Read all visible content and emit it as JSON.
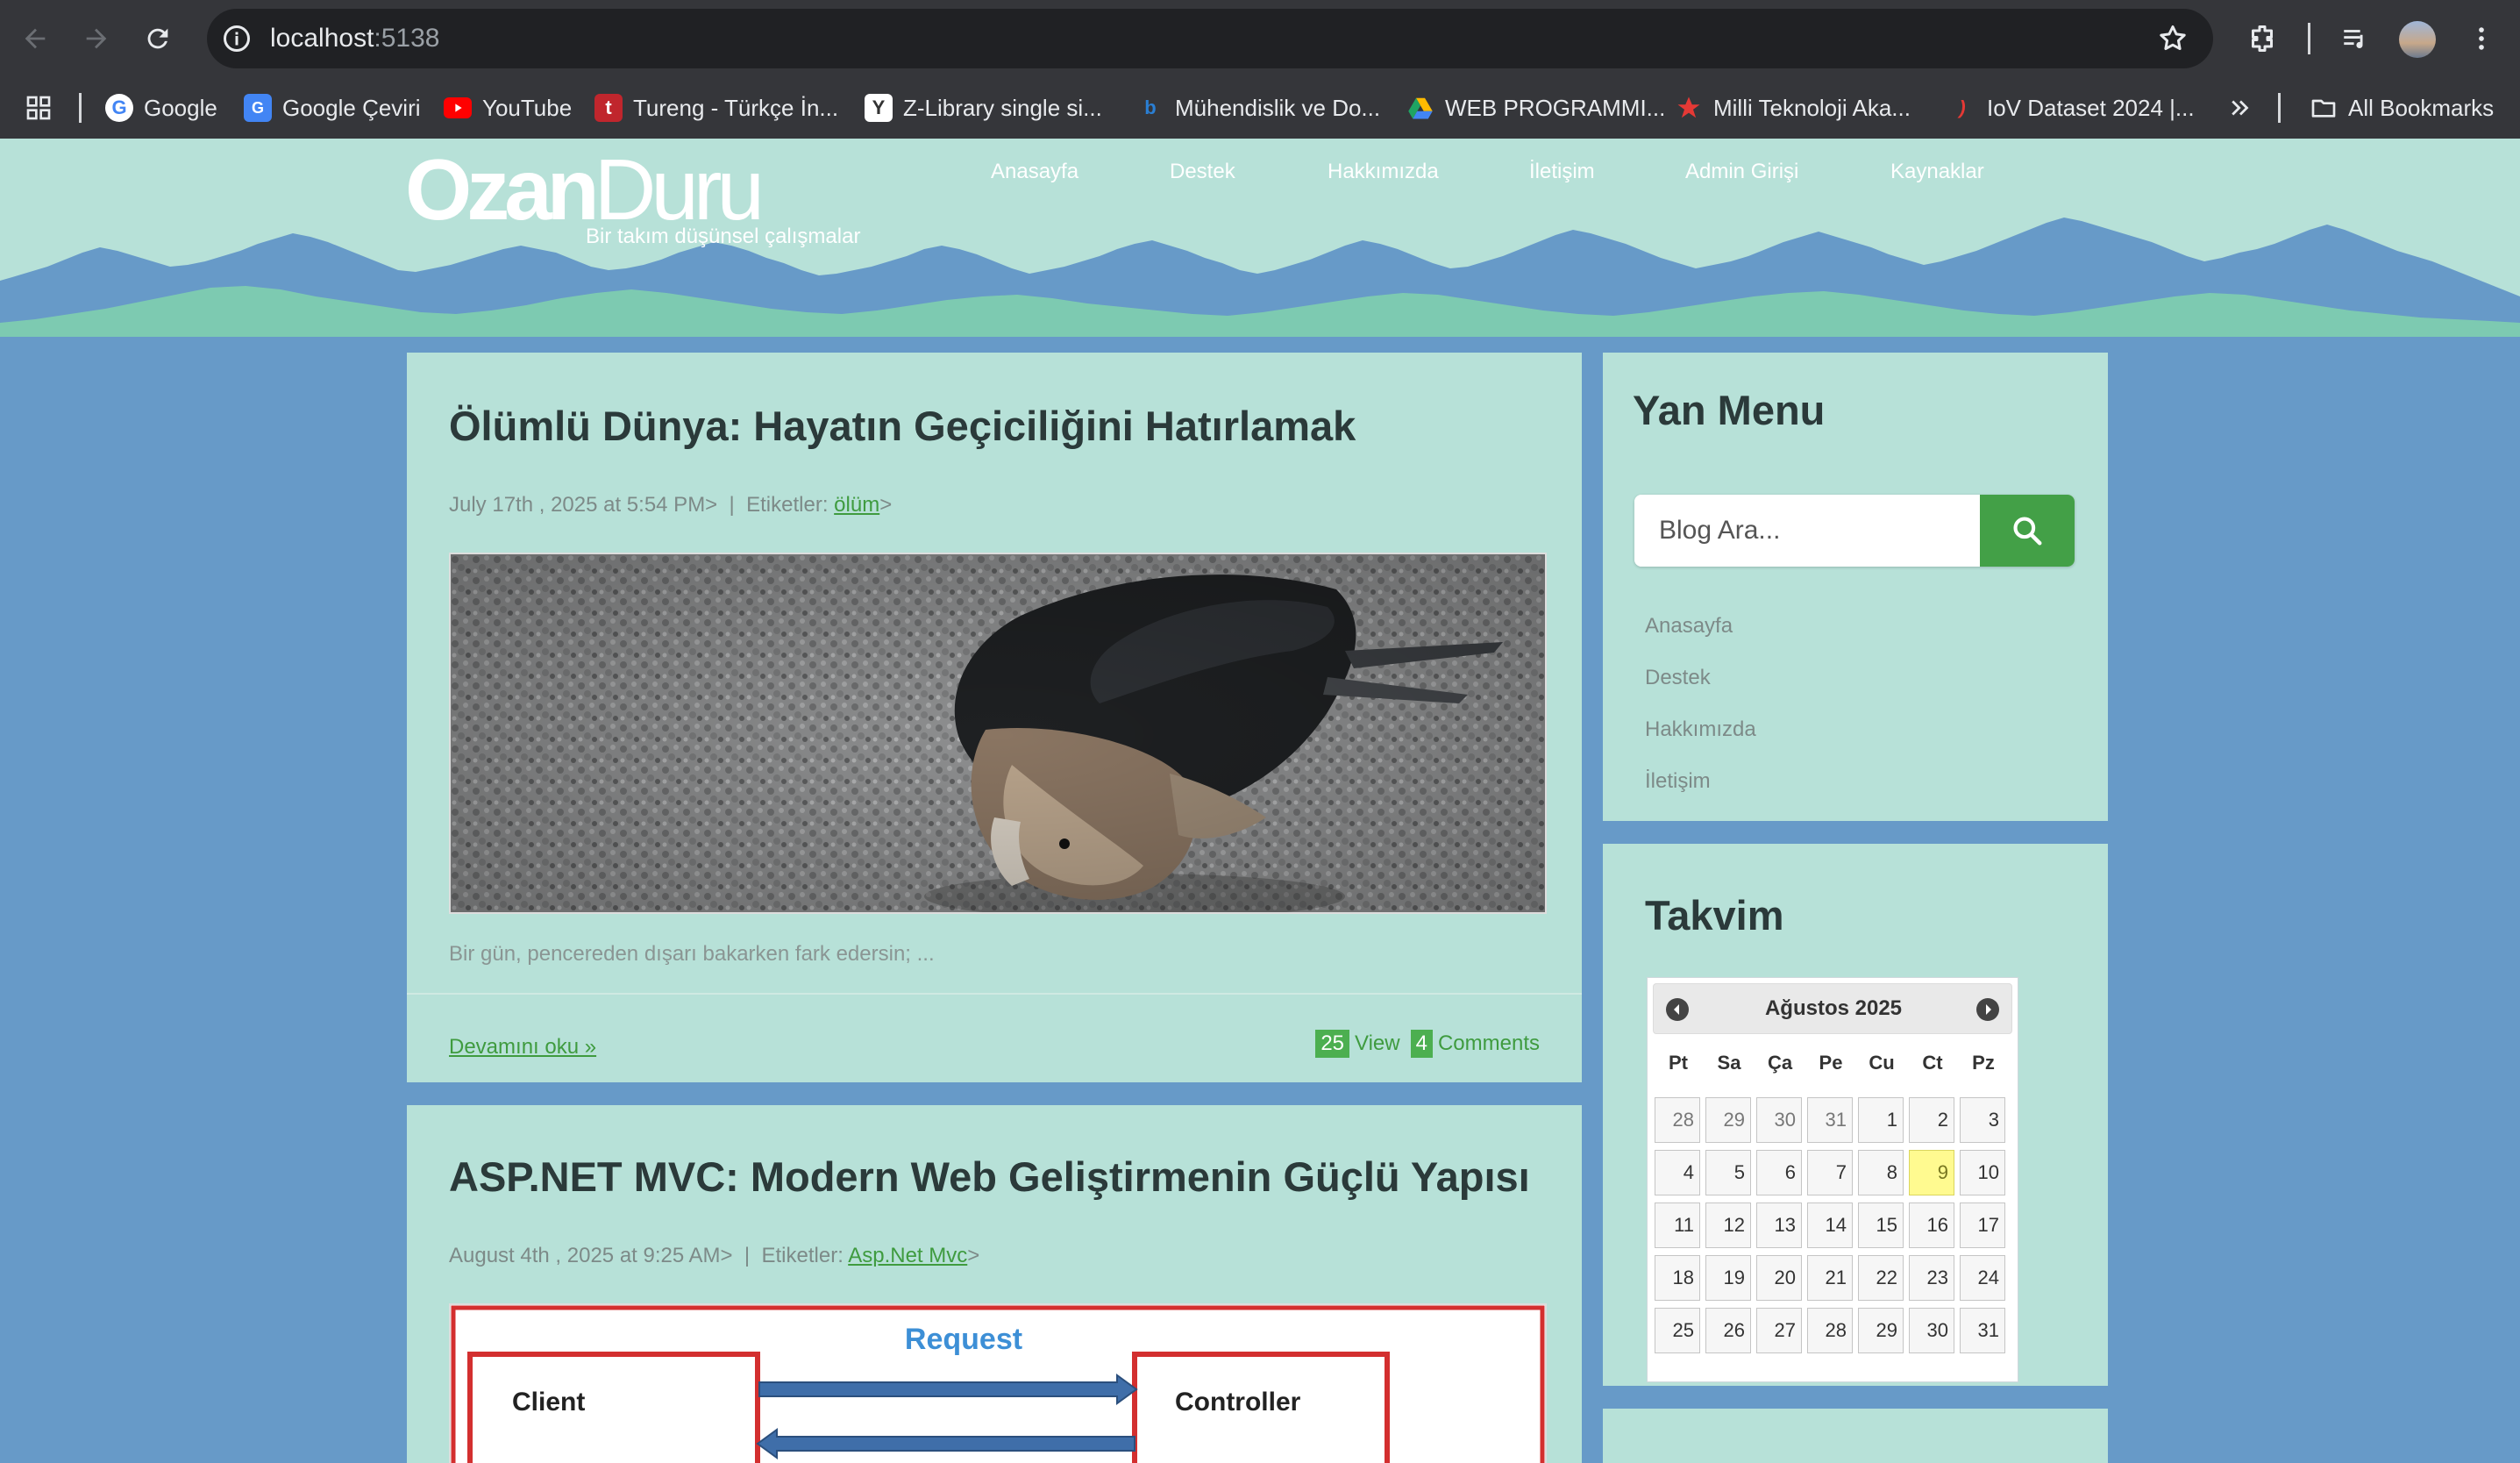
{
  "browser": {
    "url_host": "localhost",
    "url_port": ":5138",
    "bookmarks": [
      {
        "label": "Google",
        "icon": "google-icon",
        "color": "#ffffff"
      },
      {
        "label": "Google Çeviri",
        "icon": "google-translate-icon",
        "color": "#4285f4"
      },
      {
        "label": "YouTube",
        "icon": "youtube-icon",
        "color": "#ff0000"
      },
      {
        "label": "Tureng - Türkçe İn...",
        "icon": "tureng-icon",
        "color": "#c0262d"
      },
      {
        "label": "Z-Library single si...",
        "icon": "zlibrary-icon",
        "color": "#ffffff"
      },
      {
        "label": "Mühendislik ve Do...",
        "icon": "bookmark-b-icon",
        "color": "#2a7fd4"
      },
      {
        "label": "WEB PROGRAMMI...",
        "icon": "google-drive-icon",
        "color": "#1fa463"
      },
      {
        "label": "Milli Teknoloji Aka...",
        "icon": "star-logo-icon",
        "color": "#e53935"
      },
      {
        "label": "IoV Dataset 2024 |...",
        "icon": "ieee-dataport-icon",
        "color": "#e53935"
      }
    ],
    "all_bookmarks": "All Bookmarks"
  },
  "site": {
    "logo_part1": "Ozan",
    "logo_part2": "Duru",
    "tagline": "Bir takım düşünsel çalışmalar",
    "nav": [
      "Anasayfa",
      "Destek",
      "Hakkımızda",
      "İletişim",
      "Admin Girişi",
      "Kaynaklar"
    ]
  },
  "posts": [
    {
      "title": "Ölümlü Dünya: Hayatın Geçiciliğini Hatırlamak",
      "meta_date": "July 17th , 2025 at 5:54 PM>",
      "meta_sep": "|",
      "meta_tag_label": "Etiketler:",
      "meta_tag": "ölüm",
      "meta_tag_suffix": ">",
      "excerpt": "Bir gün, pencereden dışarı bakarken fark edersin; ...",
      "read_more": "Devamını oku »",
      "views": "25",
      "views_label": "View",
      "comments": "4",
      "comments_label": "Comments"
    },
    {
      "title": "ASP.NET MVC: Modern Web Geliştirmenin Güçlü Yapısı",
      "meta_date": "August 4th , 2025 at 9:25 AM>",
      "meta_sep": "|",
      "meta_tag_label": "Etiketler:",
      "meta_tag": "Asp.Net Mvc",
      "meta_tag_suffix": ">",
      "diagram": {
        "request": "Request",
        "client": "Client",
        "controller": "Controller"
      }
    }
  ],
  "sidebar": {
    "menu_title": "Yan Menu",
    "search_placeholder": "Blog Ara...",
    "links": [
      "Anasayfa",
      "Destek",
      "Hakkımızda",
      "İletişim"
    ],
    "calendar_title": "Takvim",
    "calendar": {
      "month": "Ağustos 2025",
      "weekdays": [
        "Pt",
        "Sa",
        "Ça",
        "Pe",
        "Cu",
        "Ct",
        "Pz"
      ],
      "weeks": [
        [
          "28",
          "29",
          "30",
          "31",
          "1",
          "2",
          "3"
        ],
        [
          "4",
          "5",
          "6",
          "7",
          "8",
          "9",
          "10"
        ],
        [
          "11",
          "12",
          "13",
          "14",
          "15",
          "16",
          "17"
        ],
        [
          "18",
          "19",
          "20",
          "21",
          "22",
          "23",
          "24"
        ],
        [
          "25",
          "26",
          "27",
          "28",
          "29",
          "30",
          "31"
        ]
      ],
      "today": "9"
    }
  },
  "colors": {
    "accent_green": "#43a047",
    "card_bg": "#b7e1d8",
    "page_bg": "#679ac8"
  }
}
